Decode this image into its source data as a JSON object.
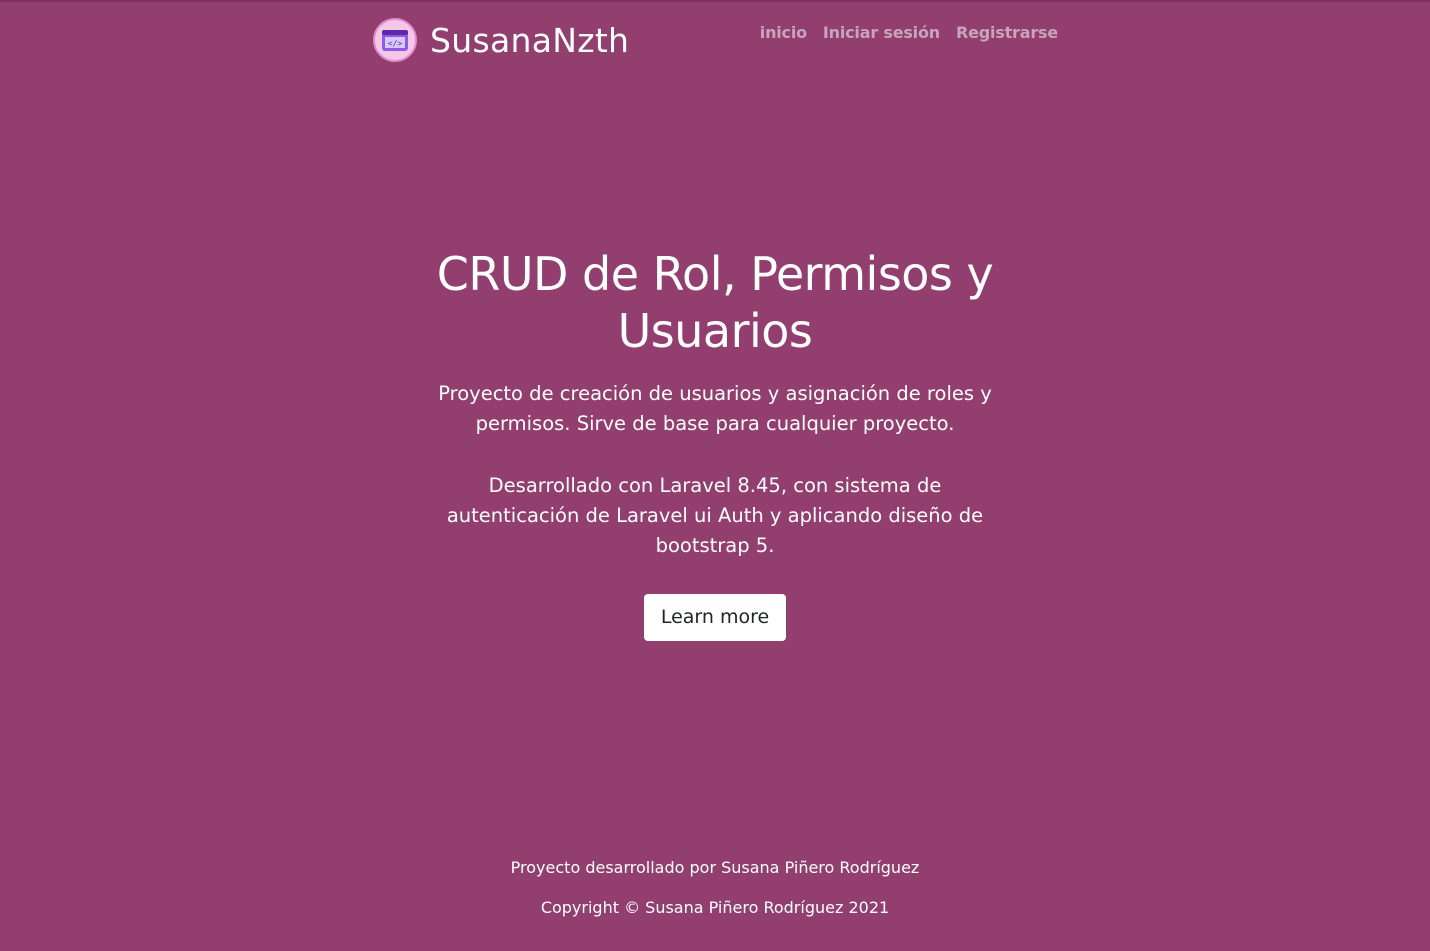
{
  "header": {
    "brand": "SusanaNzth",
    "logo_icon": "code-window-icon",
    "nav": [
      {
        "label": "inicio"
      },
      {
        "label": "Iniciar sesión"
      },
      {
        "label": "Registrarse"
      }
    ]
  },
  "hero": {
    "title": "CRUD de Rol, Permisos y Usuarios",
    "description": "Proyecto de creación de usuarios y asignación de roles y permisos. Sirve de base para cualquier proyecto.",
    "details": "Desarrollado con Laravel 8.45, con sistema de autenticación de Laravel ui Auth y aplicando diseño de bootstrap 5.",
    "cta_label": "Learn more"
  },
  "footer": {
    "credit": "Proyecto desarrollado por Susana Piñero Rodríguez",
    "copyright": "Copyright © Susana Piñero Rodríguez 2021"
  },
  "colors": {
    "background": "#923e6f",
    "nav_link": "#c8a4bb",
    "button_bg": "#ffffff",
    "button_text": "#212529"
  }
}
